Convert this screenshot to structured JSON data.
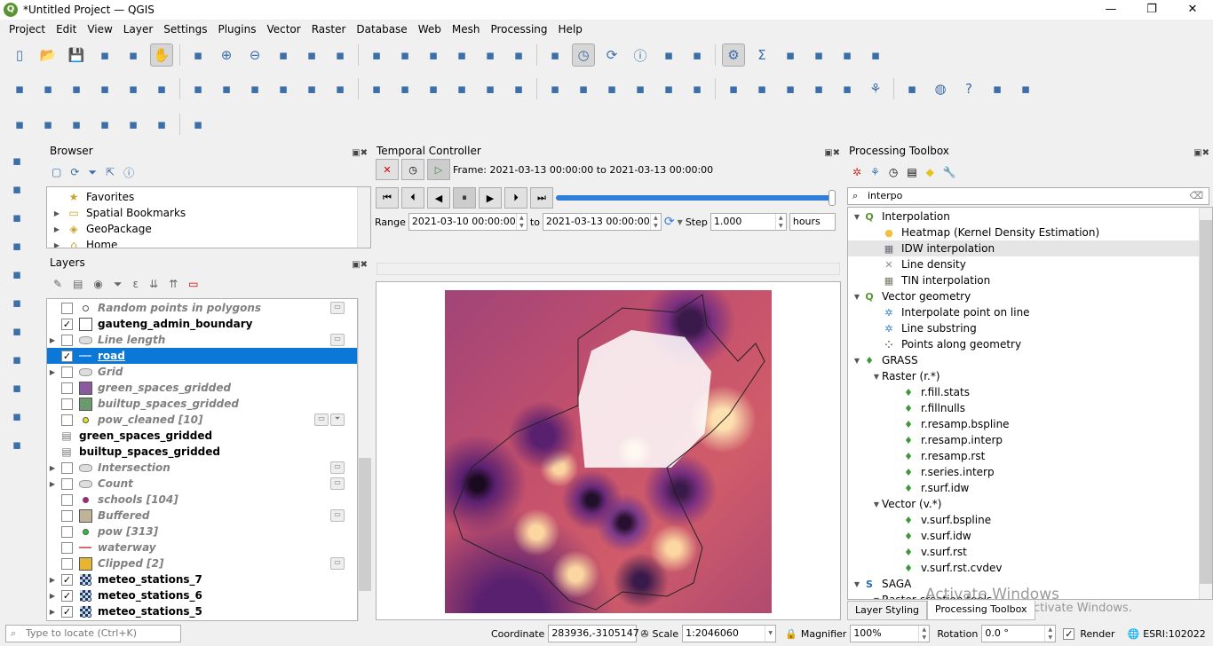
{
  "window": {
    "title": "*Untitled Project — QGIS",
    "minimize": "—",
    "maximize": "❐",
    "close": "✕"
  },
  "menu": [
    "Project",
    "Edit",
    "View",
    "Layer",
    "Settings",
    "Plugins",
    "Vector",
    "Raster",
    "Database",
    "Web",
    "Mesh",
    "Processing",
    "Help"
  ],
  "toolbar1": [
    "new-project",
    "open-project",
    "save-project",
    "save-as",
    "print-layout",
    "pan",
    "pan-to-selection",
    "zoom-in",
    "zoom-out",
    "zoom-full",
    "zoom-selection",
    "zoom-layer",
    "zoom-native",
    "zoom-last",
    "zoom-next",
    "new-map-view",
    "new-3d-view",
    "new-bookmark",
    "show-bookmarks",
    "temporal-controller",
    "refresh",
    "identify",
    "attribute-table",
    "field-calculator",
    "processing-toolbox",
    "statistics",
    "measure",
    "map-tips",
    "annotation",
    "text-annotation"
  ],
  "toolbar2": [
    "data-source-manager",
    "new-geopackage",
    "digitize",
    "edit-pen",
    "gps",
    "virtual-layer",
    "current-edits",
    "toggle-editing",
    "save-edits",
    "vertex-tool",
    "add-feature",
    "modify-attributes",
    "delete",
    "cut",
    "copy",
    "paste",
    "undo",
    "redo",
    "label-abc",
    "diagram",
    "label-pin",
    "label-highlight",
    "label-show",
    "label-move",
    "label-rotate",
    "label-change",
    "label-edit",
    "metasearch",
    "web-search",
    "python",
    "layer-grid",
    "globe",
    "help",
    "georeferencer",
    "refresh-plugin"
  ],
  "toolbar3": [
    "profile",
    "gps-tool",
    "digitize-tool",
    "select-features",
    "select-value",
    "deselect",
    "identify-feature"
  ],
  "lefttoolbar": [
    "add-vector",
    "add-raster",
    "add-mesh",
    "add-delimited-text",
    "add-spatialite",
    "add-virtual-layer",
    "add-postgis",
    "add-wms",
    "add-wfs",
    "add-wcs",
    "add-layer-more"
  ],
  "browser": {
    "title": "Browser",
    "items": [
      {
        "label": "Favorites",
        "icon": "star-icon"
      },
      {
        "label": "Spatial Bookmarks",
        "icon": "bookmark-icon"
      },
      {
        "label": "GeoPackage",
        "icon": "geopackage-icon"
      },
      {
        "label": "Home",
        "icon": "home-icon"
      }
    ]
  },
  "layers": {
    "title": "Layers",
    "items": [
      {
        "name": "Random points in polygons",
        "checked": false,
        "style": "off",
        "symbol": "point-hollow",
        "badge": true
      },
      {
        "name": "gauteng_admin_boundary",
        "checked": true,
        "style": "on",
        "symbol": "fill-white"
      },
      {
        "name": "Line length",
        "checked": false,
        "style": "off",
        "symbol": "polygon-generic",
        "badge": true,
        "expand": true
      },
      {
        "name": "road",
        "checked": true,
        "style": "sel",
        "symbol": "line-blue"
      },
      {
        "name": "Grid",
        "checked": false,
        "style": "off",
        "symbol": "polygon-generic",
        "expand": true
      },
      {
        "name": "green_spaces_gridded",
        "checked": false,
        "style": "off",
        "symbol": "fill-#8b5a9e"
      },
      {
        "name": "builtup_spaces_gridded",
        "checked": false,
        "style": "off",
        "symbol": "fill-#6a9a6e"
      },
      {
        "name": "pow_cleaned [10]",
        "checked": false,
        "style": "off",
        "symbol": "point-#e6e620",
        "badge": true,
        "filter": true
      },
      {
        "name": "green_spaces_gridded",
        "checked": null,
        "style": "on",
        "symbol": "table"
      },
      {
        "name": "builtup_spaces_gridded",
        "checked": null,
        "style": "on",
        "symbol": "table"
      },
      {
        "name": "Intersection",
        "checked": false,
        "style": "off",
        "symbol": "polygon-generic",
        "badge": true,
        "expand": true
      },
      {
        "name": "Count",
        "checked": false,
        "style": "off",
        "symbol": "polygon-generic",
        "badge": true,
        "expand": true
      },
      {
        "name": "schools [104]",
        "checked": false,
        "style": "off",
        "symbol": "point-#c0148c"
      },
      {
        "name": "Buffered",
        "checked": false,
        "style": "off",
        "symbol": "fill-#bfb497",
        "badge": true
      },
      {
        "name": "pow [313]",
        "checked": false,
        "style": "off",
        "symbol": "point-#20c830"
      },
      {
        "name": "waterway",
        "checked": false,
        "style": "off",
        "symbol": "line-#d07070"
      },
      {
        "name": "Clipped [2]",
        "checked": false,
        "style": "off",
        "symbol": "fill-#e6b432",
        "badge": true
      },
      {
        "name": "meteo_stations_7",
        "checked": true,
        "style": "on",
        "symbol": "raster",
        "expand": true
      },
      {
        "name": "meteo_stations_6",
        "checked": true,
        "style": "on",
        "symbol": "raster",
        "expand": true
      },
      {
        "name": "meteo_stations_5",
        "checked": true,
        "style": "on",
        "symbol": "raster",
        "expand": true
      }
    ]
  },
  "temporal": {
    "title": "Temporal Controller",
    "frame": "Frame: 2021-03-13 00:00:00 to 2021-03-13 00:00:00",
    "range_label": "Range",
    "range_start": "2021-03-10 00:00:00",
    "to_label": "to",
    "range_end": "2021-03-13 00:00:00",
    "step_label": "Step",
    "step": "1.000",
    "unit": "hours",
    "progress": 1.0
  },
  "processing": {
    "title": "Processing Toolbox",
    "search": "interpo",
    "tree": [
      {
        "label": "Interpolation",
        "level": 0,
        "icon": "qgis-icon",
        "expanded": true
      },
      {
        "label": "Heatmap (Kernel Density Estimation)",
        "level": 1,
        "icon": "heatmap-icon"
      },
      {
        "label": "IDW interpolation",
        "level": 1,
        "icon": "idw-icon",
        "hl": true
      },
      {
        "label": "Line density",
        "level": 1,
        "icon": "line-density-icon"
      },
      {
        "label": "TIN interpolation",
        "level": 1,
        "icon": "tin-icon"
      },
      {
        "label": "Vector geometry",
        "level": 0,
        "icon": "qgis-icon",
        "expanded": true
      },
      {
        "label": "Interpolate point on line",
        "level": 1,
        "icon": "gear-icon"
      },
      {
        "label": "Line substring",
        "level": 1,
        "icon": "gear-icon"
      },
      {
        "label": "Points along geometry",
        "level": 1,
        "icon": "points-icon"
      },
      {
        "label": "GRASS",
        "level": 0,
        "icon": "grass-icon",
        "expanded": true
      },
      {
        "label": "Raster (r.*)",
        "level": 1,
        "expanded": true
      },
      {
        "label": "r.fill.stats",
        "level": 2,
        "icon": "grass-icon"
      },
      {
        "label": "r.fillnulls",
        "level": 2,
        "icon": "grass-icon"
      },
      {
        "label": "r.resamp.bspline",
        "level": 2,
        "icon": "grass-icon"
      },
      {
        "label": "r.resamp.interp",
        "level": 2,
        "icon": "grass-icon"
      },
      {
        "label": "r.resamp.rst",
        "level": 2,
        "icon": "grass-icon"
      },
      {
        "label": "r.series.interp",
        "level": 2,
        "icon": "grass-icon"
      },
      {
        "label": "r.surf.idw",
        "level": 2,
        "icon": "grass-icon"
      },
      {
        "label": "Vector (v.*)",
        "level": 1,
        "expanded": true
      },
      {
        "label": "v.surf.bspline",
        "level": 2,
        "icon": "grass-icon"
      },
      {
        "label": "v.surf.idw",
        "level": 2,
        "icon": "grass-icon"
      },
      {
        "label": "v.surf.rst",
        "level": 2,
        "icon": "grass-icon"
      },
      {
        "label": "v.surf.rst.cvdev",
        "level": 2,
        "icon": "grass-icon"
      },
      {
        "label": "SAGA",
        "level": 0,
        "icon": "saga-icon",
        "expanded": true
      },
      {
        "label": "Raster creation tools",
        "level": 1,
        "expanded": true
      }
    ]
  },
  "tabs": [
    "Layer Styling",
    "Processing Toolbox"
  ],
  "active_tab": "Processing Toolbox",
  "watermark": {
    "line1": "Activate Windows",
    "line2": "Go to Settings to activate Windows."
  },
  "status": {
    "locate_placeholder": "Type to locate (Ctrl+K)",
    "coordinate_label": "Coordinate",
    "coordinate": "283936,-3105147",
    "scale_label": "Scale",
    "scale": "1:2046060",
    "magnifier_label": "Magnifier",
    "magnifier": "100%",
    "rotation_label": "Rotation",
    "rotation": "0.0 °",
    "render_label": "Render",
    "render_checked": true,
    "crs": "ESRI:102022"
  },
  "colors": {
    "accent": "#0b78d7",
    "map_bg": "#c3506c"
  }
}
